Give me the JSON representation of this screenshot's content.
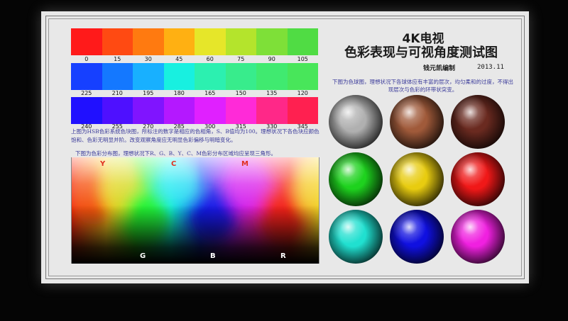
{
  "title": {
    "line1": "4K电视",
    "line2": "色彩表现与可视角度测试图"
  },
  "author": "钱元凯编制",
  "date": "2013.11",
  "hue_strips": [
    {
      "labels": [
        "0",
        "15",
        "30",
        "45",
        "60",
        "75",
        "90",
        "105"
      ],
      "colors": [
        "#ff1a1a",
        "#ff4a12",
        "#ff7a10",
        "#ffb012",
        "#e6e629",
        "#b4e42c",
        "#7ee038",
        "#50dc44"
      ]
    },
    {
      "labels": [
        "225",
        "210",
        "195",
        "180",
        "165",
        "150",
        "135",
        "120"
      ],
      "colors": [
        "#1640ff",
        "#1478ff",
        "#18b0ff",
        "#18f0e0",
        "#2cf0b0",
        "#38ec8c",
        "#40ea70",
        "#48e65a"
      ]
    },
    {
      "labels": [
        "240",
        "255",
        "270",
        "285",
        "300",
        "315",
        "330",
        "345"
      ],
      "colors": [
        "#2010ff",
        "#4e10ff",
        "#8014ff",
        "#b418ff",
        "#e020ff",
        "#ff2ad8",
        "#ff2888",
        "#ff2050"
      ]
    }
  ],
  "hsb_note": "上图为HSB色彩系统色块图，所标注的数字是相应的色相角，S、B值均为100。理想状况下各色块应颜色饱和、色彩无明显并阶。改变观察角度应无明显色彩偏移与明暗变化。",
  "gamut_note": "下图为色彩分布图，理想状况下R、G、B、Y、C、M色彩分布区域均应呈现三角形。",
  "gamut_top_labels": [
    {
      "text": "Y",
      "color": "#e03020"
    },
    {
      "text": "C",
      "color": "#e03020"
    },
    {
      "text": "M",
      "color": "#e03020"
    }
  ],
  "gamut_bottom_labels": [
    {
      "text": "G",
      "color": "#ffffff"
    },
    {
      "text": "B",
      "color": "#ffffff"
    },
    {
      "text": "R",
      "color": "#ffffff"
    }
  ],
  "sphere_note": "下图为色球图，理想状况下各球体应有丰富的层次，均匀柔和的过度，不得出现层次与色彩的环带状突变。",
  "spheres": [
    {
      "name": "gray",
      "color": "#b0b0b0"
    },
    {
      "name": "brown",
      "color": "#a05a3a"
    },
    {
      "name": "dark-brown",
      "color": "#6a2a20"
    },
    {
      "name": "green",
      "color": "#1ed21e"
    },
    {
      "name": "yellow",
      "color": "#e8cc10"
    },
    {
      "name": "red",
      "color": "#f01818"
    },
    {
      "name": "cyan",
      "color": "#20e0d0"
    },
    {
      "name": "blue",
      "color": "#1010e0"
    },
    {
      "name": "magenta",
      "color": "#f020e0"
    }
  ]
}
